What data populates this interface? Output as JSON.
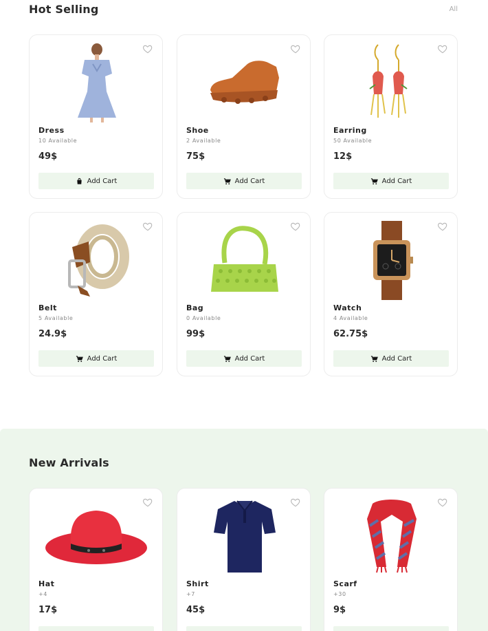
{
  "hot": {
    "title": "Hot Selling",
    "see_all": "All",
    "add_cart_label": "Add Cart",
    "products": [
      {
        "name": "Dress",
        "avail": "10 Available",
        "price": "49$"
      },
      {
        "name": "Shoe",
        "avail": "2 Available",
        "price": "75$"
      },
      {
        "name": "Earring",
        "avail": "50 Available",
        "price": "12$"
      },
      {
        "name": "Belt",
        "avail": "5 Available",
        "price": "24.9$"
      },
      {
        "name": "Bag",
        "avail": "0 Available",
        "price": "99$"
      },
      {
        "name": "Watch",
        "avail": "4 Available",
        "price": "62.75$"
      }
    ]
  },
  "arrivals": {
    "title": "New Arrivals",
    "products": [
      {
        "name": "Hat",
        "avail": "+4",
        "price": "17$"
      },
      {
        "name": "Shirt",
        "avail": "+7",
        "price": "45$"
      },
      {
        "name": "Scarf",
        "avail": "+30",
        "price": "9$"
      }
    ]
  },
  "colors": {
    "accent_bg": "#edf6ec",
    "heart": "#b5b5b5"
  },
  "icons": {
    "heart": "heart-icon",
    "cart": "cart-icon",
    "bag": "bag-icon"
  }
}
